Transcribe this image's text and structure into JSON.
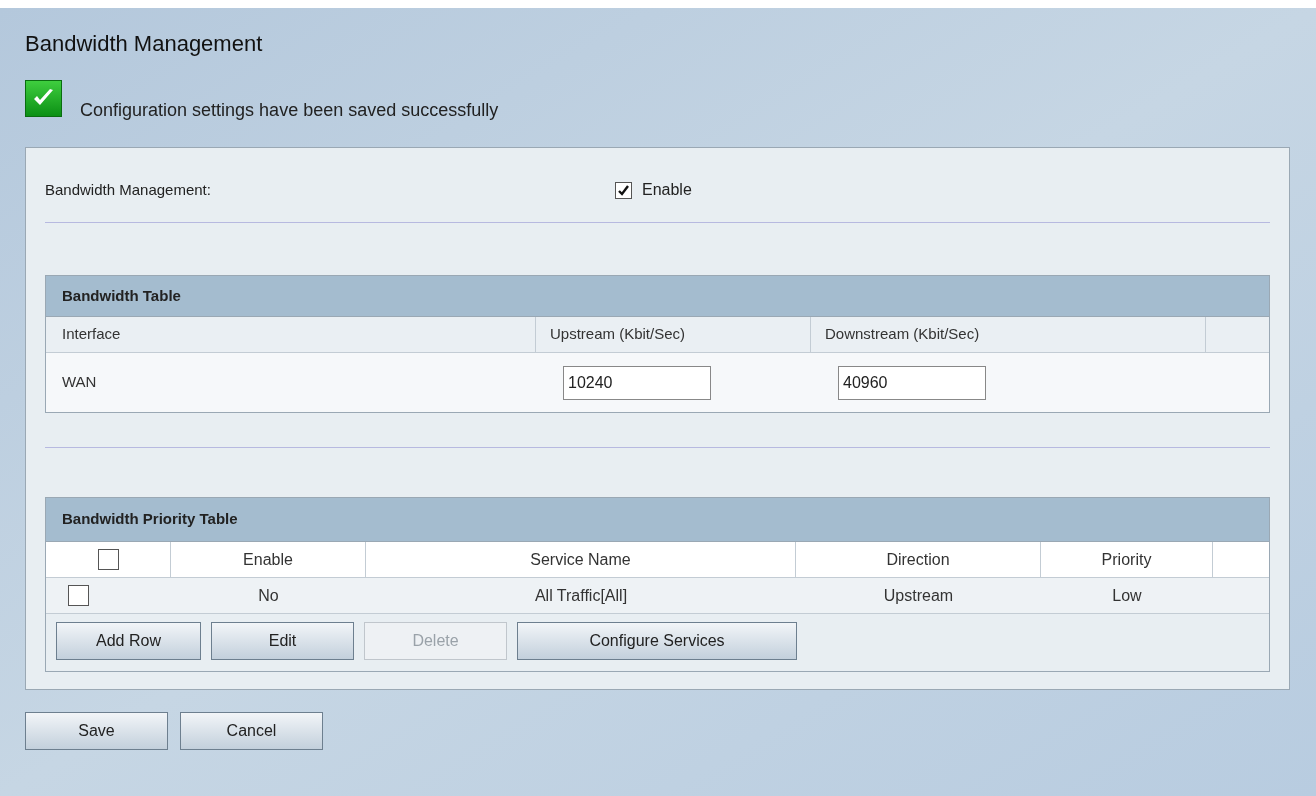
{
  "page_title": "Bandwidth Management",
  "status_message": {
    "kind": "success",
    "text": "Configuration settings have been saved successfully"
  },
  "bandwidth_management": {
    "label": "Bandwidth Management:",
    "option_label": "Enable",
    "checked": true
  },
  "bandwidth_table": {
    "title": "Bandwidth Table",
    "columns": [
      "Interface",
      "Upstream (Kbit/Sec)",
      "Downstream (Kbit/Sec)"
    ],
    "rows": [
      {
        "interface": "WAN",
        "upstream": "10240",
        "downstream": "40960"
      }
    ]
  },
  "priority_table": {
    "title": "Bandwidth Priority Table",
    "select_all_checked": false,
    "columns": [
      "Enable",
      "Service Name",
      "Direction",
      "Priority"
    ],
    "rows": [
      {
        "checked": false,
        "enable": "No",
        "service_name": "All Traffic[All]",
        "direction": "Upstream",
        "priority": "Low"
      }
    ],
    "buttons": [
      {
        "label": "Add Row",
        "disabled": false
      },
      {
        "label": "Edit",
        "disabled": false
      },
      {
        "label": "Delete",
        "disabled": true
      },
      {
        "label": "Configure Services",
        "disabled": false
      }
    ]
  },
  "footer_buttons": [
    {
      "label": "Save"
    },
    {
      "label": "Cancel"
    }
  ]
}
